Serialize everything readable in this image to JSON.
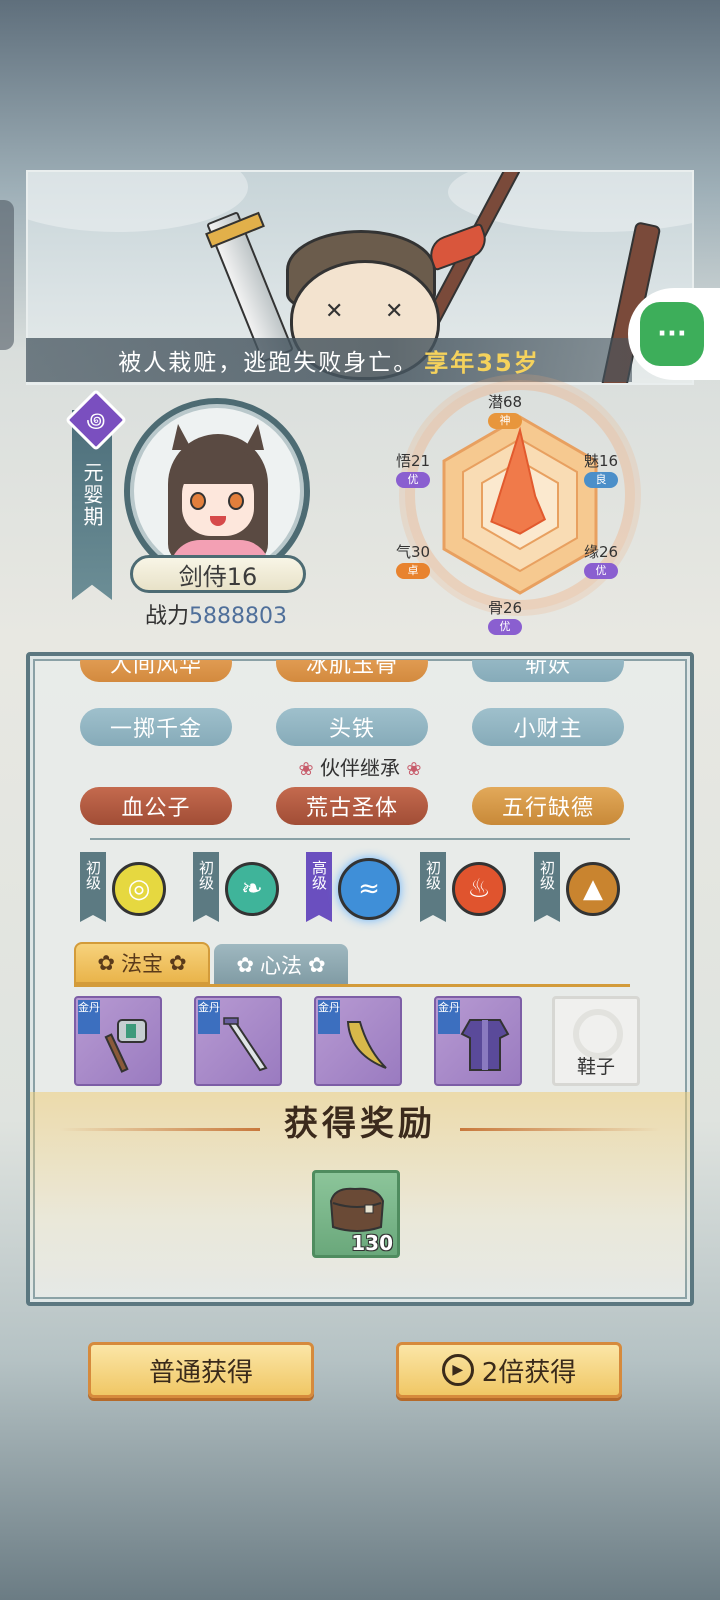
{
  "banner": {
    "death_text": "被人栽赃，逃跑失败身亡。",
    "age_text": "享年35岁"
  },
  "menu": {
    "icon": "more-dots-icon",
    "glyph": "···"
  },
  "character": {
    "realm": "元婴期",
    "realm_icon": "swirl-icon",
    "name": "剑侍16",
    "power_label": "战力",
    "power_value": "5888803"
  },
  "stats": {
    "potential": {
      "label": "潜68",
      "grade": "神",
      "color": "#e8963c",
      "value": 68
    },
    "charm": {
      "label": "魅16",
      "grade": "良",
      "color": "#4b8fc9",
      "value": 16
    },
    "fate": {
      "label": "缘26",
      "grade": "优",
      "color": "#8a5fd0",
      "value": 26
    },
    "bone": {
      "label": "骨26",
      "grade": "优",
      "color": "#8a5fd0",
      "value": 26
    },
    "qi": {
      "label": "气30",
      "grade": "卓",
      "color": "#e8832e",
      "value": 30
    },
    "wisdom": {
      "label": "悟21",
      "grade": "优",
      "color": "#8a5fd0",
      "value": 21
    }
  },
  "traits": {
    "row_partial": [
      "人间风华",
      "冰肌玉骨",
      "斩妖"
    ],
    "row1": [
      "一掷千金",
      "头铁",
      "小财主"
    ],
    "partner_title": "伙伴继承",
    "partner_flower": "❀",
    "partner": [
      "血公子",
      "荒古圣体",
      "五行缺德"
    ]
  },
  "elements": [
    {
      "tag": "初级",
      "icon": "metal-swirl-icon",
      "color": "#e6d840",
      "glyph": "◎",
      "high": false
    },
    {
      "tag": "初级",
      "icon": "wood-leaf-icon",
      "color": "#3fb49a",
      "glyph": "❧",
      "high": false
    },
    {
      "tag": "高级",
      "icon": "water-wave-icon",
      "color": "#3f8fd8",
      "glyph": "≈",
      "high": true
    },
    {
      "tag": "初级",
      "icon": "fire-flame-icon",
      "color": "#e0542e",
      "glyph": "♨",
      "high": false
    },
    {
      "tag": "初级",
      "icon": "earth-mountain-icon",
      "color": "#c9842f",
      "glyph": "▲",
      "high": false
    }
  ],
  "tabs": {
    "treasure": "法宝",
    "method": "心法",
    "flower": "✿"
  },
  "items": [
    {
      "icon": "hammer-icon",
      "quality": "金丹"
    },
    {
      "icon": "dagger-icon",
      "quality": "金丹"
    },
    {
      "icon": "curved-blade-icon",
      "quality": "金丹"
    },
    {
      "icon": "robe-icon",
      "quality": "金丹"
    }
  ],
  "empty_slot": {
    "label": "鞋子"
  },
  "reward": {
    "title": "获得奖励",
    "item_icon": "leather-pouch-icon",
    "count": "130"
  },
  "buttons": {
    "normal": "普通获得",
    "double": "2倍获得",
    "play_glyph": "▶"
  },
  "colors": {
    "panel_border": "#5b7780",
    "accent_gold": "#f5d25c",
    "power_value": "#4f6f9a"
  }
}
